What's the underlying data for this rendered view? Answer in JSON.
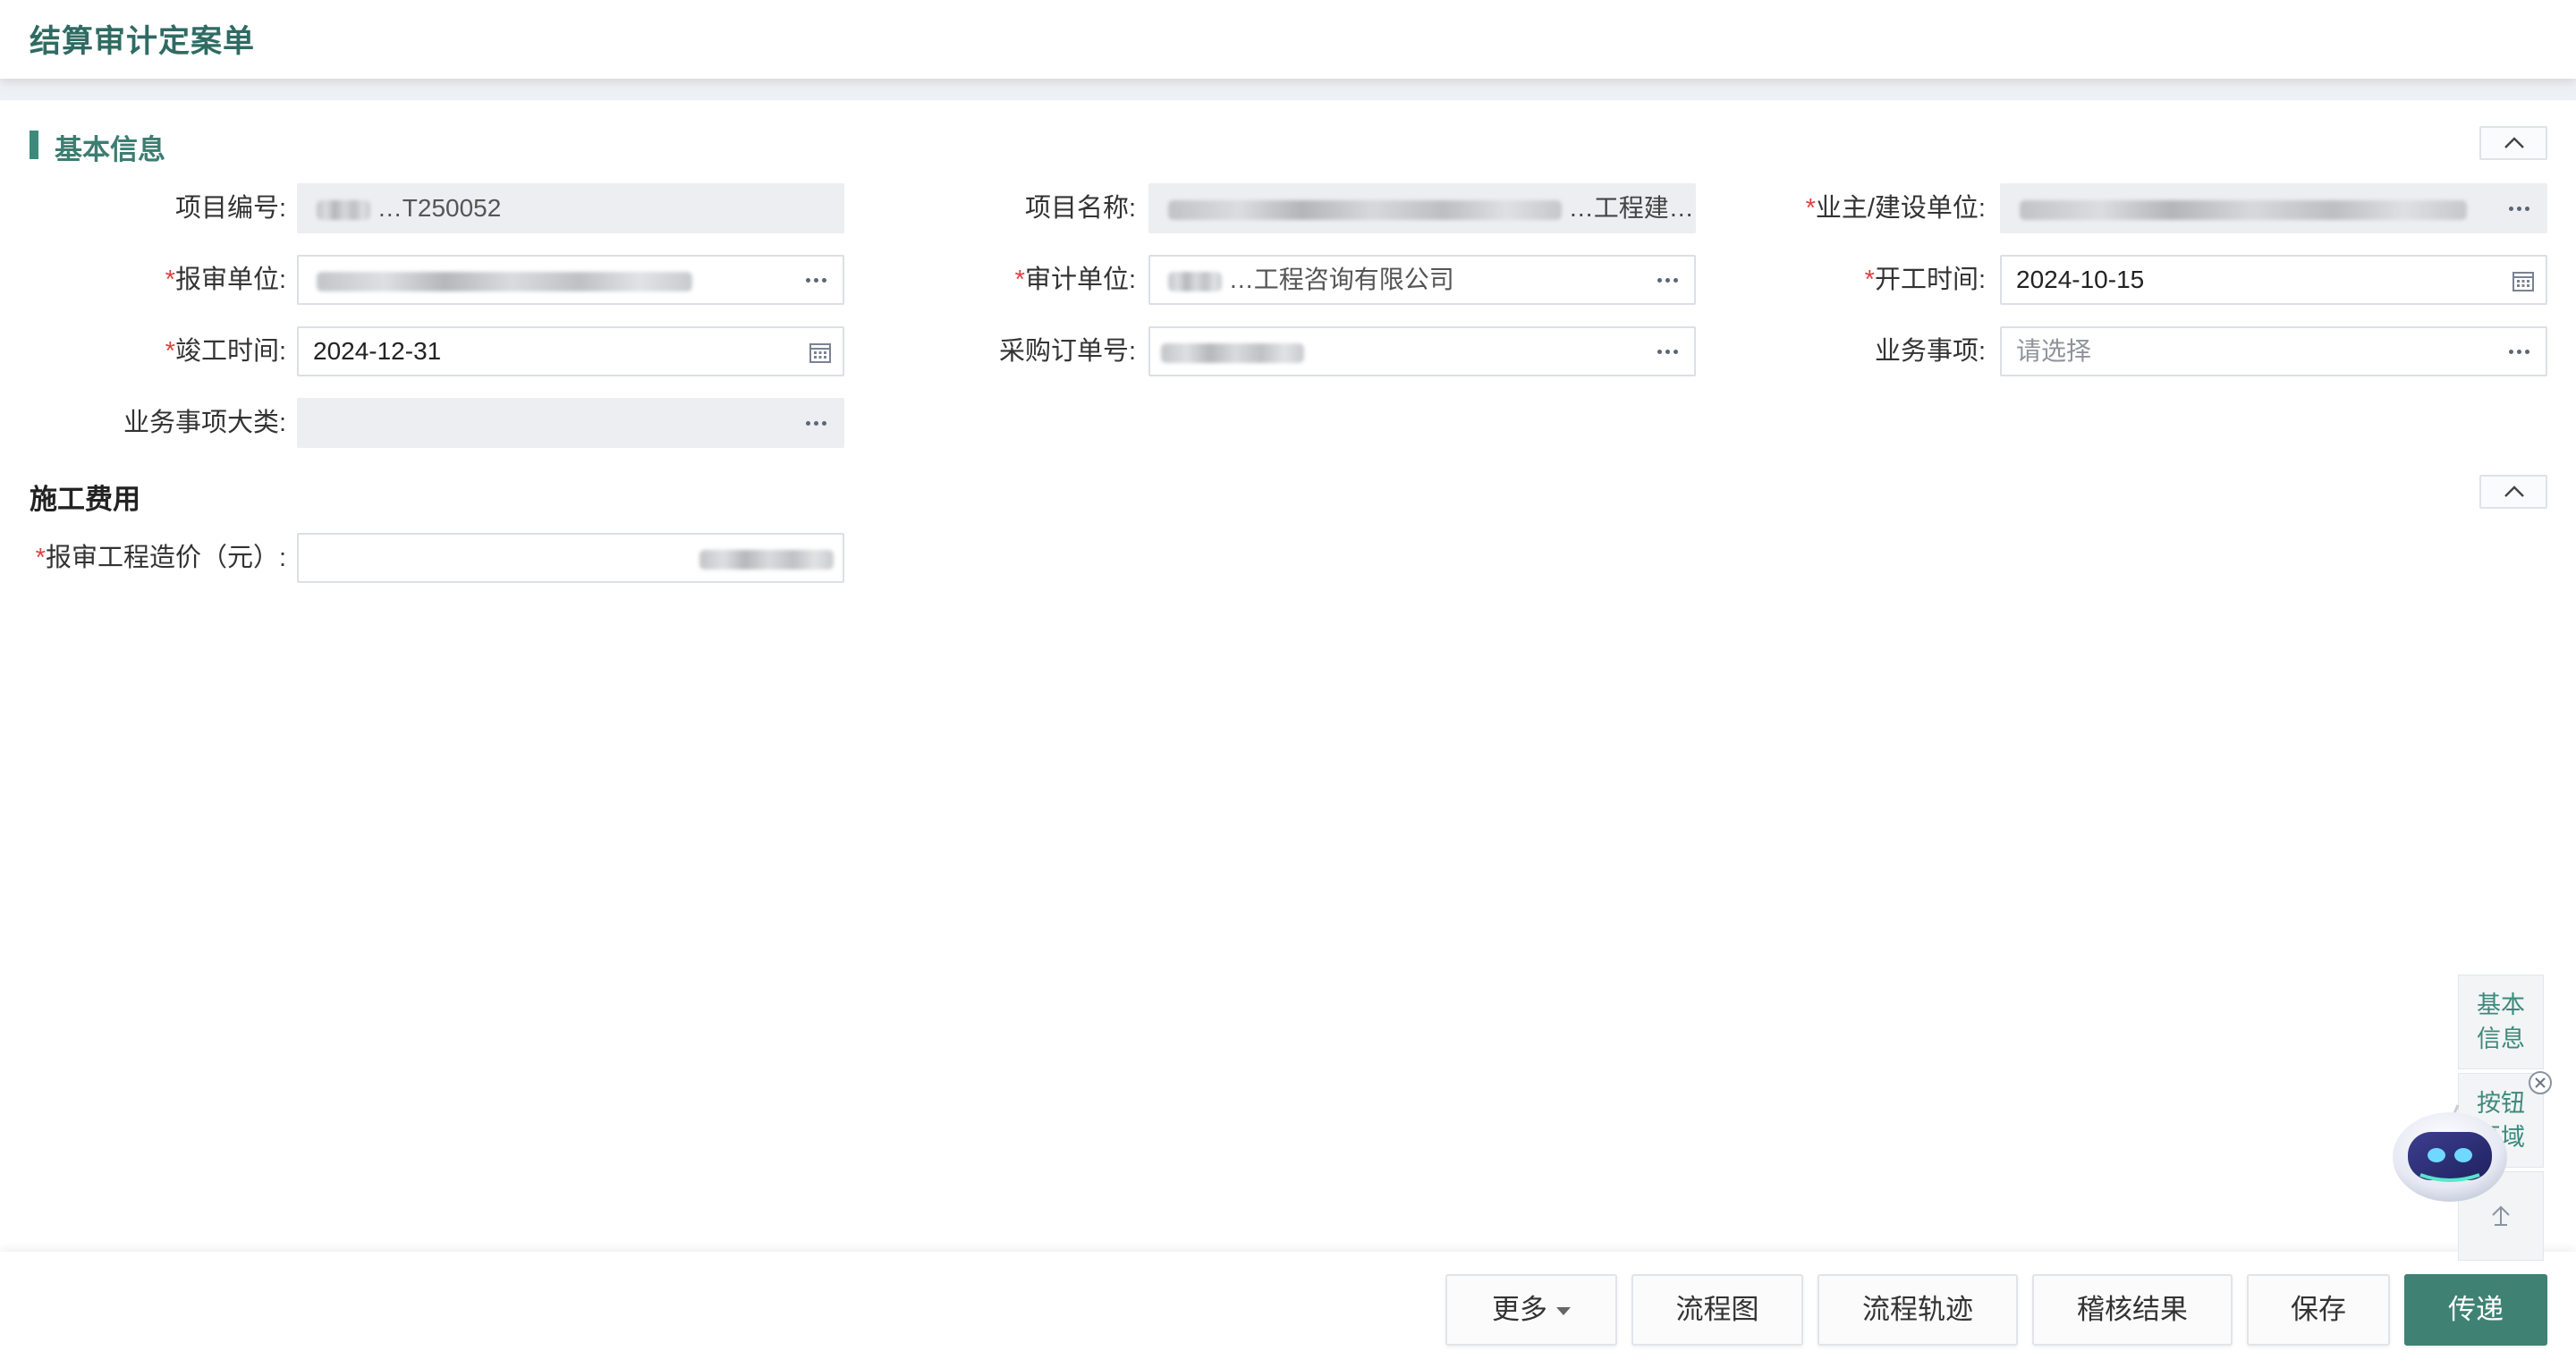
{
  "header": {
    "title": "结算审计定案单"
  },
  "sections": {
    "basic": {
      "title": "基本信息"
    },
    "cost": {
      "title": "施工费用"
    }
  },
  "fields": {
    "project_no": {
      "label": "项目编号:",
      "value": "…T250052"
    },
    "project_name": {
      "label": "项目名称:",
      "value": "…工程建…"
    },
    "owner_unit": {
      "label": "业主/建设单位:",
      "value": ""
    },
    "submit_unit": {
      "label": "报审单位:",
      "value": ""
    },
    "audit_unit": {
      "label": "审计单位:",
      "value": "…工程咨询有限公司"
    },
    "start_date": {
      "label": "开工时间:",
      "value": "2024-10-15"
    },
    "end_date": {
      "label": "竣工时间:",
      "value": "2024-12-31"
    },
    "po_no": {
      "label": "采购订单号:",
      "value": ""
    },
    "business_item": {
      "label": "业务事项:",
      "placeholder": "请选择"
    },
    "business_category": {
      "label": "业务事项大类:",
      "value": ""
    },
    "submit_cost": {
      "label": "报审工程造价（元）:",
      "value": ""
    }
  },
  "side_nav": {
    "basic_info": "基本\n信息",
    "button_area": "按钮\n区域"
  },
  "footer": {
    "more": "更多",
    "flowchart": "流程图",
    "flow_track": "流程轨迹",
    "audit_result": "稽核结果",
    "save": "保存",
    "send": "传递"
  },
  "colors": {
    "accent": "#3f8274",
    "required": "#e04040"
  }
}
